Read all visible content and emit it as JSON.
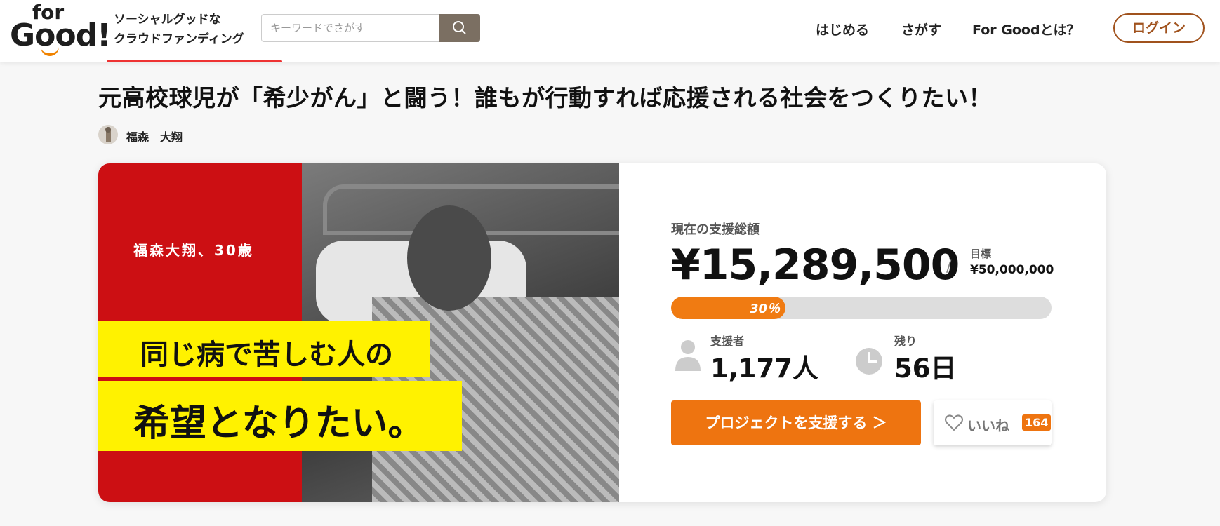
{
  "header": {
    "logo": {
      "line1": "for",
      "line2": "Good!"
    },
    "tagline": [
      "ソーシャルグッドな",
      "クラウドファンディング"
    ],
    "search": {
      "placeholder": "キーワードでさがす"
    },
    "nav": [
      "はじめる",
      "さがす",
      "For Goodとは？"
    ],
    "login": "ログイン"
  },
  "project": {
    "title": "元高校球児が「希少がん」と闘う！誰もが行動すれば応援される社会をつくりたい！",
    "author": "福森　大翔"
  },
  "hero": {
    "subtitle": "福森大翔、30歳",
    "line1": "同じ病で苦しむ人の",
    "line2": "希望となりたい。"
  },
  "funding": {
    "total_label": "現在の支援総額",
    "total": "¥15,289,500",
    "separator": "/",
    "goal_label": "目標",
    "goal": "¥50,000,000",
    "progress_text": "30％",
    "progress_fraction": 0.3,
    "supporters_label": "支援者",
    "supporters": "1,177人",
    "remaining_label": "残り",
    "remaining": "56日",
    "support_button": "プロジェクトを支援する ＞",
    "like_label": "いいね",
    "like_count": "164"
  },
  "colors": {
    "accent": "#ee7410",
    "hero_red": "#cc0f13",
    "highlight": "#fff200",
    "search_button": "#7b6f62",
    "login_border": "#a0521d"
  },
  "icons": [
    "search-icon",
    "person-icon",
    "clock-icon",
    "heart-icon",
    "chevron-right-icon"
  ]
}
